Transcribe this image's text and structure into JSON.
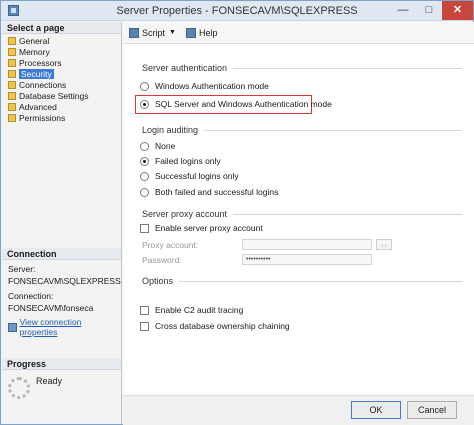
{
  "window": {
    "title": "Server Properties - FONSECAVM\\SQLEXPRESS"
  },
  "left": {
    "select_header": "Select a page",
    "pages": [
      "General",
      "Memory",
      "Processors",
      "Security",
      "Connections",
      "Database Settings",
      "Advanced",
      "Permissions"
    ],
    "selected_page": "Security",
    "connection": {
      "header": "Connection",
      "server_label": "Server:",
      "server_value": "FONSECAVM\\SQLEXPRESS",
      "connection_label": "Connection:",
      "connection_value": "FONSECAVM\\fonseca",
      "link_text": "View connection properties"
    },
    "progress": {
      "header": "Progress",
      "status": "Ready"
    }
  },
  "toolbar": {
    "script_label": "Script",
    "help_label": "Help"
  },
  "server_auth": {
    "header": "Server authentication",
    "options": [
      "Windows Authentication mode",
      "SQL Server and Windows Authentication mode"
    ],
    "selected": "SQL Server and Windows Authentication mode"
  },
  "login_auditing": {
    "header": "Login auditing",
    "options": [
      "None",
      "Failed logins only",
      "Successful logins only",
      "Both failed and successful logins"
    ],
    "selected": "Failed logins only"
  },
  "proxy": {
    "header": "Server proxy account",
    "enable_label": "Enable server proxy account",
    "enable_checked": false,
    "proxy_account_label": "Proxy account:",
    "proxy_account_value": "",
    "password_label": "Password:",
    "password_value": "••••••••••",
    "browse_label": "..."
  },
  "options": {
    "header": "Options",
    "c2_label": "Enable C2 audit tracing",
    "c2_checked": false,
    "cross_db_label": "Cross database ownership chaining",
    "cross_db_checked": false
  },
  "buttons": {
    "ok": "OK",
    "cancel": "Cancel"
  },
  "colors": {
    "highlight": "#d63b3b",
    "selected_page_bg": "#3b7bd4",
    "link": "#1d5fb4"
  }
}
